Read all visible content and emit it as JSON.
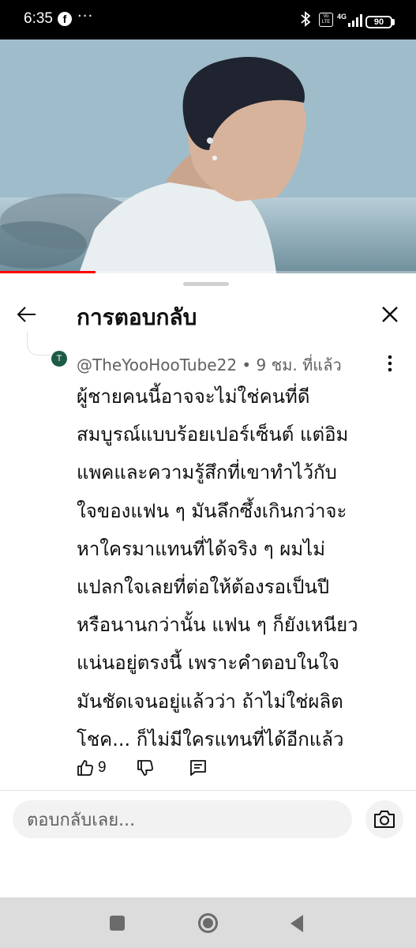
{
  "status_bar": {
    "time": "6:35",
    "notification_icons": [
      "facebook-icon",
      "more-dots-icon"
    ],
    "system_icons": [
      "bluetooth-icon",
      "volte-icon",
      "4g-icon",
      "signal-icon",
      "battery-icon"
    ],
    "volte_label": "Vo LTE",
    "network_type": "4G",
    "battery_level": "90"
  },
  "video": {
    "progress": 0.23,
    "progress_color": "#ff0000"
  },
  "panel": {
    "title": "การตอบกลับ",
    "back_icon": "arrow-left-icon",
    "close_icon": "close-icon"
  },
  "comment": {
    "avatar_letter": "T",
    "avatar_color": "#1e5b47",
    "meta": "@TheYooHooTube22 • 9 ชม. ที่แล้ว",
    "lines": [
      "ผู้ชายคนนี้อาจจะไม่ใช่คนที่ดี",
      "สมบูรณ์แบบร้อยเปอร์เซ็นต์ แต่อิม",
      "แพคและความรู้สึกที่เขาทำไว้กับ",
      "ใจของแฟน ๆ มันลึกซึ้งเกินกว่าจะ",
      "หาใครมาแทนที่ได้จริง ๆ ผมไม่",
      "แปลกใจเลยที่ต่อให้ต้องรอเป็นปี",
      "หรือนานกว่านั้น แฟน ๆ ก็ยังเหนียว",
      "แน่นอยู่ตรงนี้ เพราะคำตอบในใจ",
      "มันชัดเจนอยู่แล้วว่า ถ้าไม่ใช่ผลิต",
      "โชค... ก็ไม่มีใครแทนที่ได้อีกแล้ว"
    ],
    "like_count": "9"
  },
  "reply_box": {
    "placeholder": "ตอบกลับเลย...",
    "camera_icon": "camera-icon"
  },
  "nav_bar": {
    "buttons": [
      "recent-apps-icon",
      "home-icon",
      "back-icon"
    ]
  }
}
